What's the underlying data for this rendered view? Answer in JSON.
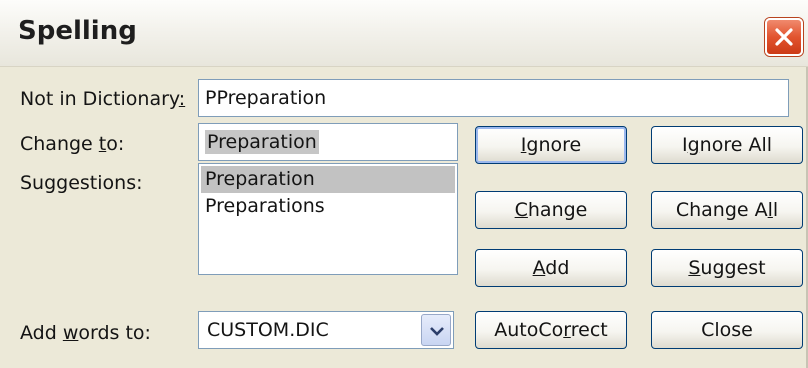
{
  "window": {
    "title": "Spelling"
  },
  "not_in_dictionary": {
    "label_pre": "Not in Dictionary",
    "label_accel": ":",
    "value": "PPreparation"
  },
  "change_to": {
    "label_pre": "Change ",
    "label_accel": "t",
    "label_post": "o:",
    "value": "Preparation"
  },
  "suggestions": {
    "label": "Suggestions:",
    "items": [
      "Preparation",
      "Preparations"
    ],
    "selected_index": 0
  },
  "add_words_to": {
    "label_pre": "Add ",
    "label_accel": "w",
    "label_post": "ords to:",
    "value": "CUSTOM.DIC"
  },
  "buttons": {
    "ignore": {
      "pre": "",
      "accel": "I",
      "post": "gnore"
    },
    "ignore_all": {
      "pre": "I",
      "accel": "g",
      "post": "nore All"
    },
    "change": {
      "pre": "",
      "accel": "C",
      "post": "hange"
    },
    "change_all": {
      "pre": "Change A",
      "accel": "l",
      "post": "l"
    },
    "add": {
      "pre": "",
      "accel": "A",
      "post": "dd"
    },
    "suggest": {
      "pre": "",
      "accel": "S",
      "post": "uggest"
    },
    "autocorrect": {
      "pre": "AutoCo",
      "accel": "r",
      "post": "rect"
    },
    "close": {
      "pre": "Close",
      "accel": "",
      "post": ""
    }
  },
  "icons": {
    "close": "close-icon",
    "dropdown": "chevron-down-icon"
  },
  "colors": {
    "dialog_bg": "#ece9d8",
    "close_button": "#e2542f",
    "selection": "#c2c2c2",
    "field_border": "#7f9db9"
  }
}
